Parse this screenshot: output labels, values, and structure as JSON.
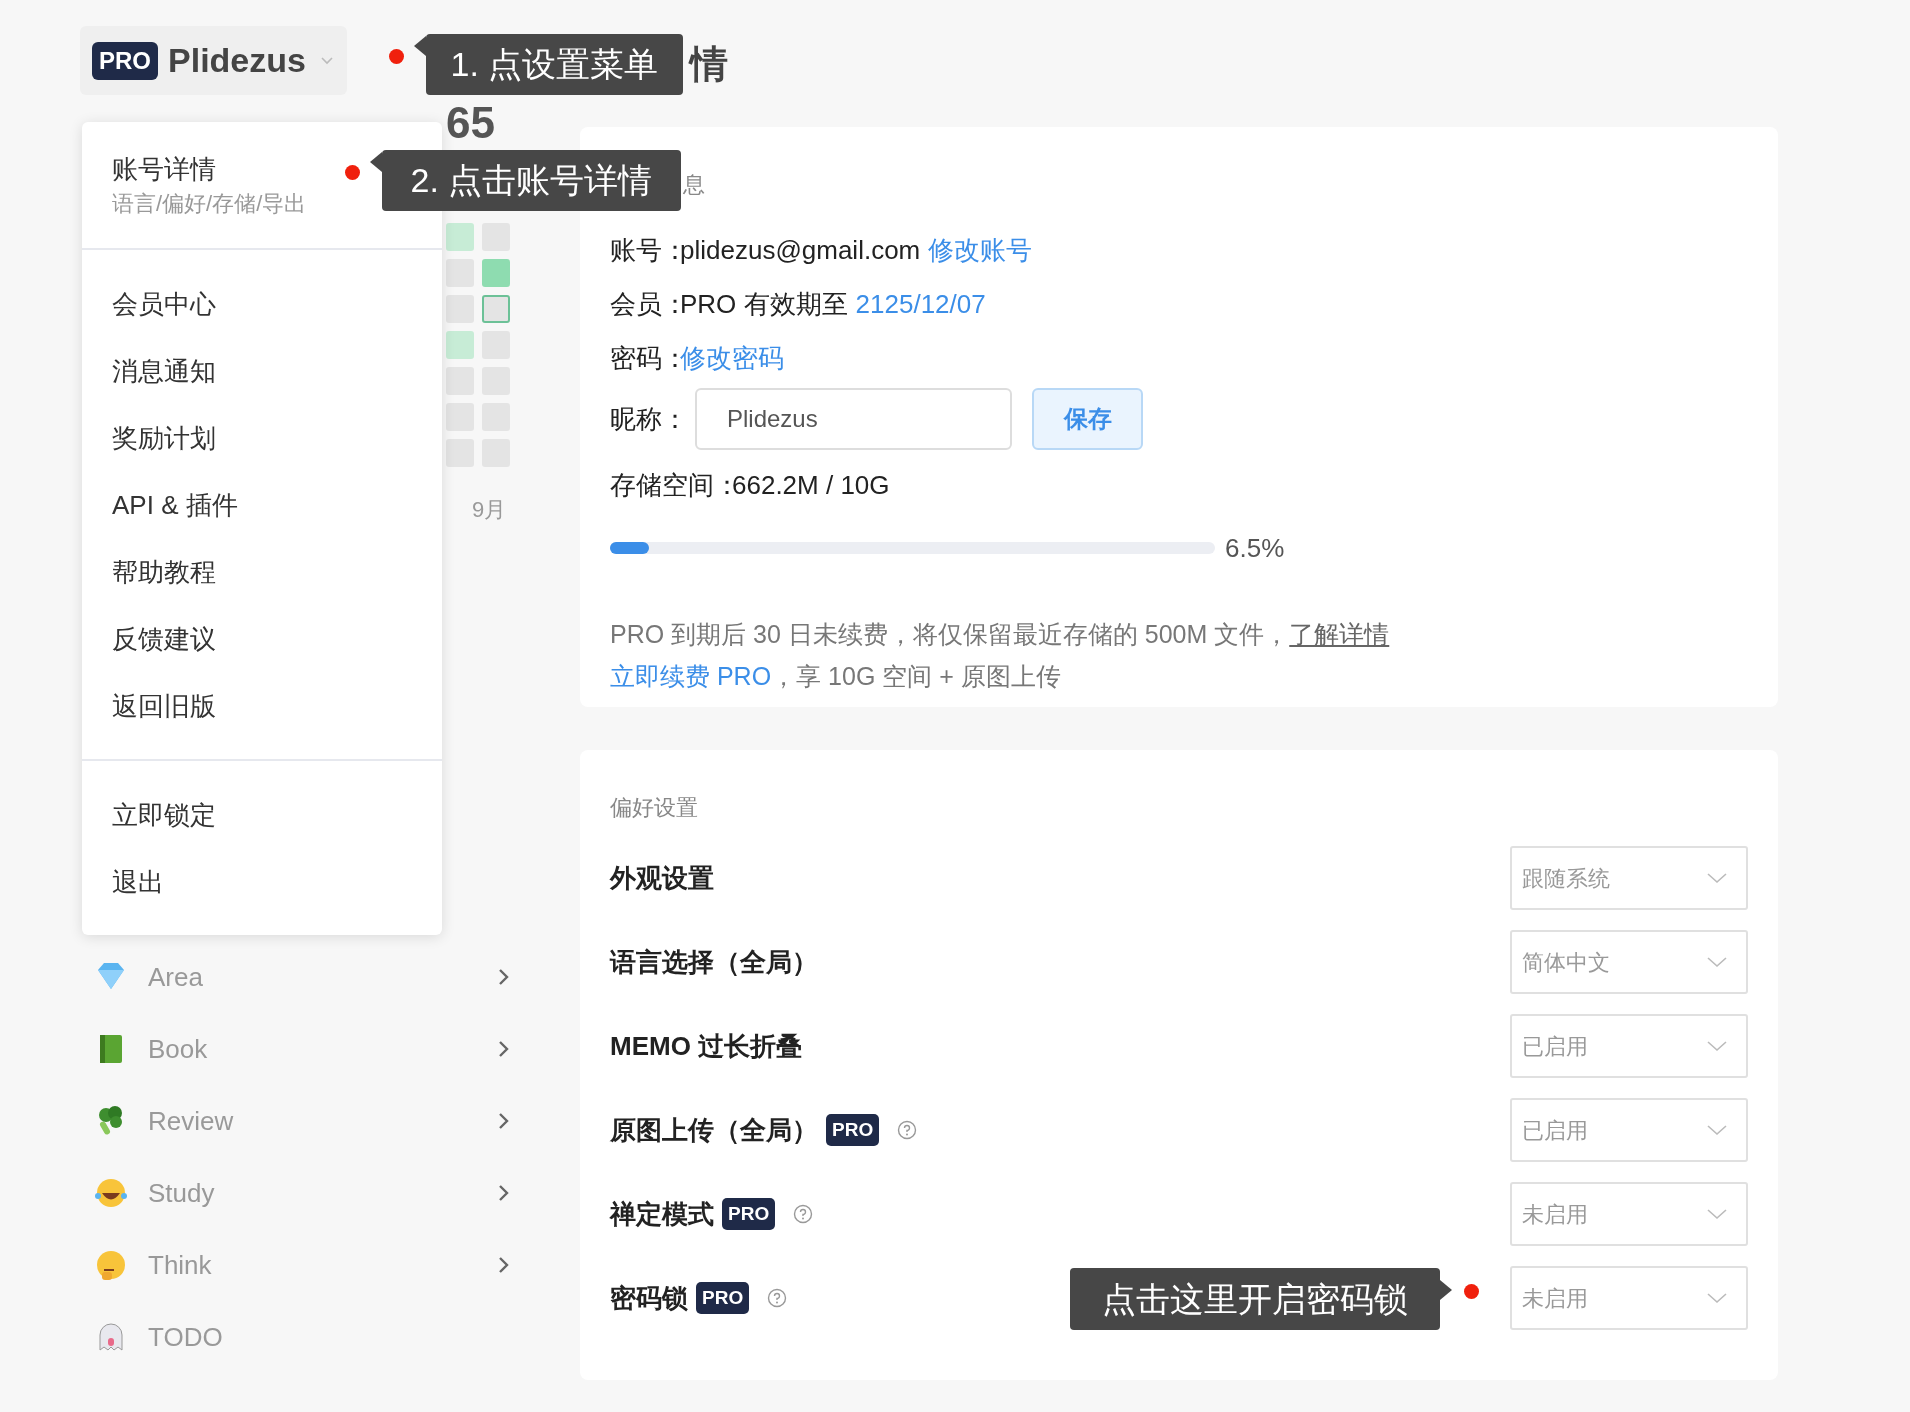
{
  "account_menu_button": {
    "badge": "PRO",
    "name": "Plidezus"
  },
  "page_title_visible": "情",
  "stats": {
    "count_visible": "65",
    "month": "9月",
    "cells": [
      {
        "kind": "light"
      },
      {
        "kind": "empty"
      },
      {
        "kind": "empty"
      },
      {
        "kind": "strong"
      },
      {
        "kind": "empty"
      },
      {
        "kind": "today"
      },
      {
        "kind": "light"
      },
      {
        "kind": "empty"
      },
      {
        "kind": "empty"
      },
      {
        "kind": "empty"
      },
      {
        "kind": "empty"
      },
      {
        "kind": "empty"
      },
      {
        "kind": "empty"
      },
      {
        "kind": "empty"
      }
    ]
  },
  "menu": {
    "sections": [
      {
        "items": [
          {
            "label": "账号详情",
            "sublabel": "语言/偏好/存储/导出"
          }
        ]
      },
      {
        "items": [
          {
            "label": "会员中心"
          },
          {
            "label": "消息通知"
          },
          {
            "label": "奖励计划"
          },
          {
            "label": "API & 插件"
          },
          {
            "label": "帮助教程"
          },
          {
            "label": "反馈建议"
          },
          {
            "label": "返回旧版"
          }
        ]
      },
      {
        "items": [
          {
            "label": "立即锁定"
          },
          {
            "label": "退出"
          }
        ]
      }
    ]
  },
  "sidebar": {
    "items": [
      {
        "kind": "diamond",
        "label": "Area",
        "expandable": true
      },
      {
        "kind": "book",
        "label": "Book",
        "expandable": true
      },
      {
        "kind": "broccoli",
        "label": "Review",
        "expandable": true
      },
      {
        "kind": "laugh",
        "label": "Study",
        "expandable": true
      },
      {
        "kind": "think",
        "label": "Think",
        "expandable": true
      },
      {
        "kind": "ghost",
        "label": "TODO",
        "expandable": false
      }
    ]
  },
  "account_card": {
    "title_visible": "息",
    "account": {
      "label": "账号：",
      "value": "plidezus@gmail.com",
      "link": "修改账号"
    },
    "membership": {
      "label": "会员：",
      "value": "PRO 有效期至",
      "date": "2125/12/07"
    },
    "password": {
      "label": "密码：",
      "link": "修改密码"
    },
    "nickname": {
      "label": "昵称：",
      "value": "Plidezus",
      "button": "保存"
    },
    "storage": {
      "label": "存储空间：",
      "value": "662.2M / 10G",
      "level": 0.065,
      "reading": "6.5%"
    },
    "notice": "PRO 到期后 30 日未续费，将仅保留最近存储的 500M 文件，",
    "notice_link": "了解详情",
    "renew_link": "立即续费 PRO",
    "renew_text": "，享 10G 空间 + 原图上传"
  },
  "preferences": {
    "title": "偏好设置",
    "rows": [
      {
        "label": "外观设置",
        "help": false,
        "value": "跟随系统"
      },
      {
        "label": "语言选择（全局）",
        "help": false,
        "value": "简体中文"
      },
      {
        "label": "MEMO 过长折叠",
        "help": false,
        "value": "已启用"
      },
      {
        "label": "原图上传（全局）",
        "badge": "PRO",
        "help": true,
        "value": "已启用"
      },
      {
        "label": "禅定模式",
        "badge": "PRO",
        "help": true,
        "value": "未启用"
      },
      {
        "label": "密码锁",
        "badge": "PRO",
        "help": true,
        "value": "未启用"
      }
    ]
  },
  "tooltips": [
    {
      "text": "1. 点设置菜单"
    },
    {
      "text": "2. 点击账号详情"
    },
    {
      "text": "点击这里开启密码锁"
    }
  ]
}
